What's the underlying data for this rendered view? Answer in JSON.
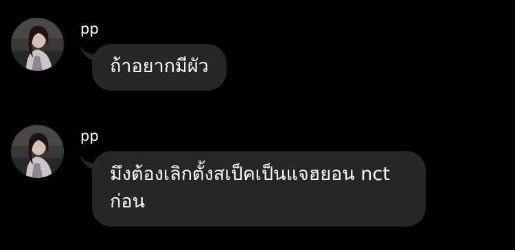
{
  "conversation": {
    "messages": [
      {
        "sender": "pp",
        "text": "ถ้าอยากมีผัว",
        "avatar": "profile-photo-icon"
      },
      {
        "sender": "pp",
        "text": "มึงต้องเลิกตั้งสเป็คเป็นแจฮยอน nct ก่อน",
        "avatar": "profile-photo-icon"
      }
    ]
  },
  "colors": {
    "background": "#000000",
    "bubble": "#262626",
    "text": "#ffffff"
  }
}
